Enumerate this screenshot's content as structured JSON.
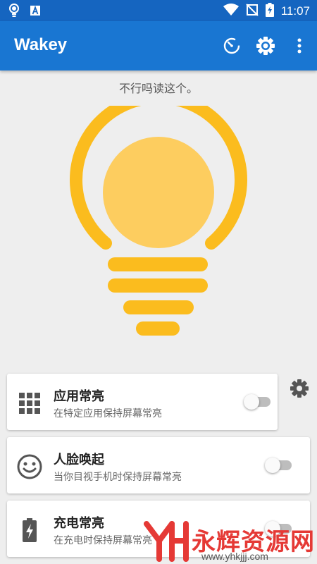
{
  "status_bar": {
    "time": "11:07",
    "icons": [
      "lightbulb-icon",
      "a-notification-icon",
      "wifi-icon",
      "no-sim-icon",
      "battery-charging-icon"
    ]
  },
  "app_bar": {
    "title": "Wakey",
    "actions": [
      "timer-icon",
      "brightness-settings-icon",
      "more-vert-icon"
    ]
  },
  "hint": "不行吗读这个。",
  "bulb": {
    "ring_color": "#fbbc1e",
    "fill_color": "#fdcd5f",
    "lines_color": "#fbbc1e",
    "state": "on"
  },
  "cards": [
    {
      "icon": "apps-grid-icon",
      "title": "应用常亮",
      "subtitle": "在特定应用保持屏幕常亮",
      "enabled": false
    },
    {
      "icon": "face-icon",
      "title": "人脸唤起",
      "subtitle": "当你目视手机时保持屏幕常亮",
      "enabled": false
    },
    {
      "icon": "battery-charging-icon",
      "title": "充电常亮",
      "subtitle": "在充电时保持屏幕常亮",
      "enabled": false
    }
  ],
  "watermark": {
    "text": "永辉资源网",
    "url": "www.yhkjjj.com"
  },
  "colors": {
    "primary": "#1976d2",
    "primary_dark": "#1565c0",
    "accent": "#fbbc1e",
    "background": "#eeeeee"
  }
}
